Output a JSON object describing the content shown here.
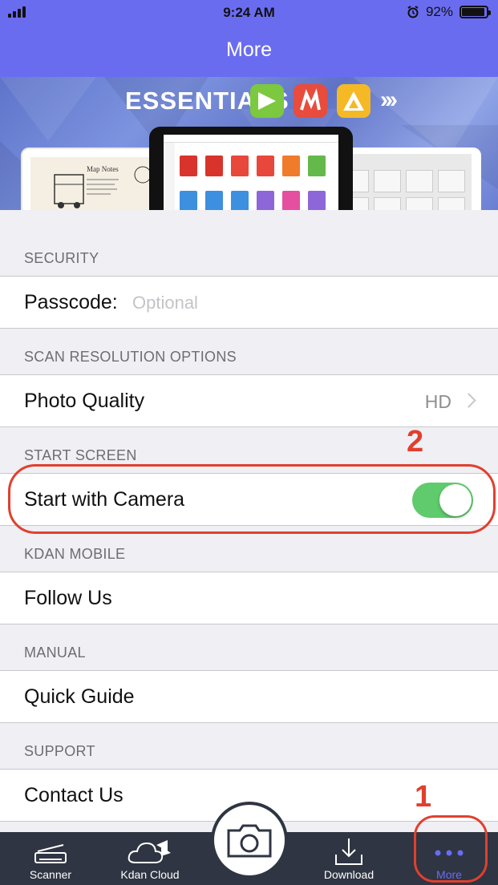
{
  "status": {
    "time": "9:24 AM",
    "battery": "92%",
    "battery_level": 0.92,
    "signal_bars": 4,
    "alarm_icon": "alarm-clock-icon"
  },
  "nav": {
    "title": "More"
  },
  "banner": {
    "heading": "ESSENTIALS",
    "chevrons": "›››",
    "map_notes": "Map Notes"
  },
  "sections": {
    "security": {
      "header": "SECURITY",
      "passcode_label": "Passcode:",
      "passcode_placeholder": "Optional"
    },
    "scan": {
      "header": "SCAN RESOLUTION OPTIONS",
      "photo_quality_label": "Photo Quality",
      "photo_quality_value": "HD"
    },
    "start": {
      "header": "START SCREEN",
      "camera_label": "Start with Camera",
      "camera_on": true
    },
    "kdan": {
      "header": "KDAN MOBILE",
      "follow_label": "Follow Us"
    },
    "manual": {
      "header": "MANUAL",
      "guide_label": "Quick Guide"
    },
    "support": {
      "header": "SUPPORT",
      "contact_label": "Contact Us"
    }
  },
  "annotations": {
    "one": "1",
    "two": "2"
  },
  "tabbar": {
    "scanner": "Scanner",
    "kdan_cloud": "Kdan Cloud",
    "download": "Download",
    "more": "More",
    "active_color": "#6a6cf0"
  },
  "colors": {
    "nav": "#6a6cf0",
    "toggle_on": "#5fcb6c",
    "annotation": "#e0402e",
    "tabbar": "#2f3542"
  }
}
